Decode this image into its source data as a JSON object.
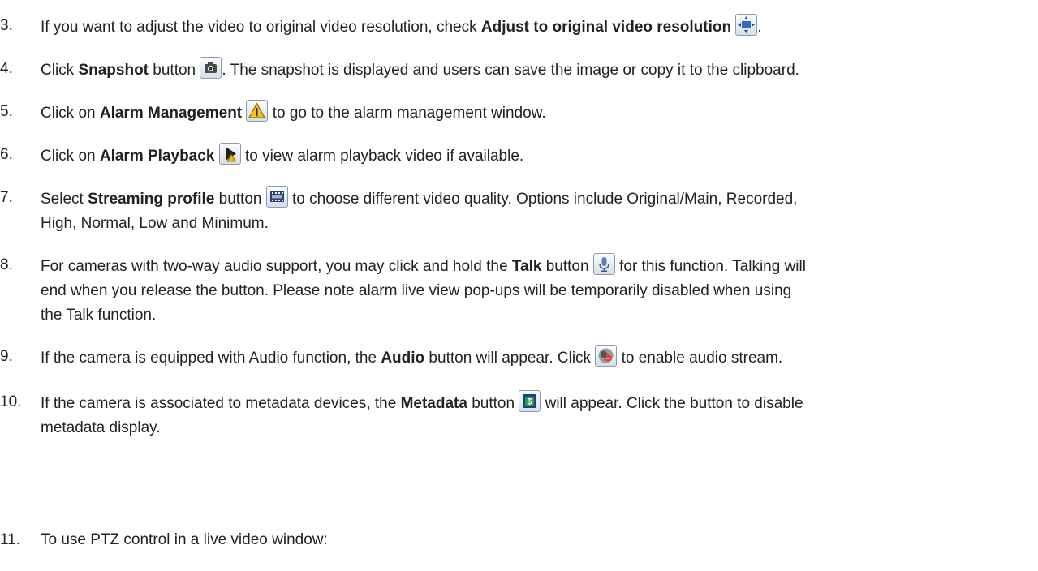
{
  "items": [
    {
      "num": "3.",
      "t1": "If you want to adjust the video to original video resolution, check ",
      "b1": "Adjust to original video resolution",
      "t2": ".",
      "icon": "adjust-resolution-icon"
    },
    {
      "num": "4.",
      "t1": "Click ",
      "b1": "Snapshot",
      "t2": " button ",
      "t3": ". The snapshot is displayed and users can save the image or copy it to the clipboard.",
      "icon": "camera-icon"
    },
    {
      "num": "5.",
      "t1": "Click on ",
      "b1": "Alarm Management",
      "t2": " to go to the alarm management window.",
      "icon": "warning-icon"
    },
    {
      "num": "6.",
      "t1": "Click on ",
      "b1": "Alarm Playback",
      "t2": " to view alarm playback video if available.",
      "icon": "alarm-playback-icon"
    },
    {
      "num": "7.",
      "t1": "Select ",
      "b1": "Streaming profile",
      "t2": " button ",
      "t3": " to choose different video quality.  Options include Original/Main, Recorded,",
      "t4": "High, Normal, Low and Minimum.",
      "icon": "film-strip-icon"
    },
    {
      "num": "8.",
      "t1": "For cameras with two-way audio support, you may click and hold the ",
      "b1": "Talk",
      "t2": " button ",
      "t3": " for this function.  Talking will",
      "t4": "end when you release the button.  Please note alarm live view pop-ups will be temporarily disabled when using",
      "t5": "the Talk function.",
      "icon": "microphone-icon"
    },
    {
      "num": "9.",
      "t1": "If the camera is equipped with Audio function, the ",
      "b1": "Audio",
      "t2": " button will appear. Click ",
      "t3": " to enable audio stream.",
      "icon": "audio-muted-icon"
    },
    {
      "num": "10.",
      "t1": "If the camera is associated to metadata devices, the ",
      "b1": "Metadata",
      "t2": " button ",
      "t3": " will appear. Click the button to disable",
      "t4": "metadata display.",
      "icon": "metadata-dollar-icon"
    },
    {
      "num": "11.",
      "t1": "To use PTZ control in a live video window:"
    }
  ]
}
